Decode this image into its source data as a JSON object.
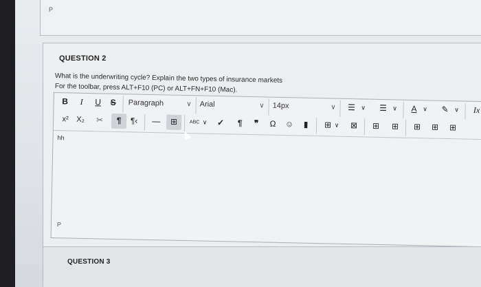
{
  "prev_question": {
    "p_label": "P"
  },
  "question2": {
    "title": "QUESTION 2",
    "text": "What is the underwriting cycle? Explain the two types of insurance markets",
    "instructions": "For the toolbar, press ALT+F10 (PC) or ALT+FN+F10 (Mac).",
    "editor_content": "hh",
    "path_label": "P"
  },
  "toolbar": {
    "bold": "B",
    "italic": "I",
    "underline": "U",
    "strike": "S",
    "paragraph": "Paragraph",
    "font": "Arial",
    "size": "14px",
    "chevron": "∨",
    "superscript": "x²",
    "subscript": "X₂",
    "clear_format": "✂",
    "ltr": "¶",
    "rtl": "¶‹",
    "hr": "—",
    "insert": "⊞",
    "spell": "ABC",
    "check": "✓",
    "pilcrow": "¶",
    "quote": "❞",
    "omega": "Ω",
    "emoji": "☺",
    "bookmark": "▮",
    "unordered": "☰",
    "ordered": "☰",
    "font_color": "A",
    "highlight": "✎",
    "clear_italic": "Ix",
    "table": "⊞",
    "x_box": "⊠"
  },
  "question3": {
    "title": "QUESTION 3"
  }
}
